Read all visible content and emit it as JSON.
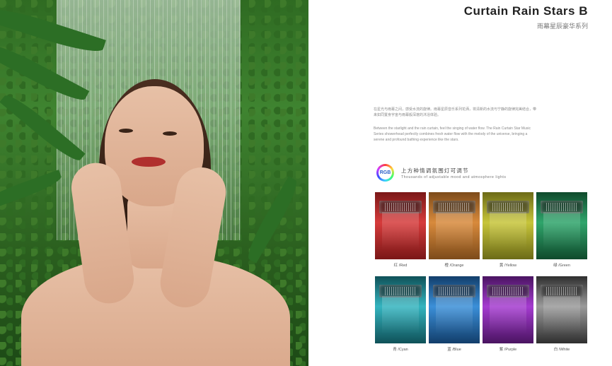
{
  "header": {
    "title": "Curtain Rain Stars B",
    "subtitle": "雨幕星辰豪华系列"
  },
  "intro": {
    "cn": "在星光与雨幕之间，感受水流的旋律。雨幕星辰音乐系列花洒，将清新的水流与宁静的旋律完美结合，带来如同置身宇宙与雨幕般深邃的沐浴体验。",
    "en": "Between the starlight and the rain curtain, feel the singing of water flow. The Rain Curtain Star Music Series showerhead perfectly combines fresh water flow with the melody of the universe, bringing a serene and profound bathing experience like the stars."
  },
  "lights": {
    "badge": "RGB",
    "heading_cn": "上方种情调氛围灯可调节",
    "heading_en": "Thousands of adjustable mood and atmosphere lights",
    "swatches": [
      {
        "label": "红 /Red",
        "color": "#d63b3b",
        "dark": "#7a1717"
      },
      {
        "label": "橙 /Orange",
        "color": "#d88a3c",
        "dark": "#7d4b1a"
      },
      {
        "label": "黄 /Yellow",
        "color": "#c7c53a",
        "dark": "#6c6b17"
      },
      {
        "label": "绿 /Green",
        "color": "#2fa56b",
        "dark": "#0f4a2c"
      },
      {
        "label": "青 /Cyan",
        "color": "#34b4bf",
        "dark": "#0f5158"
      },
      {
        "label": "蓝 /Blue",
        "color": "#3b8fd8",
        "dark": "#123e6b"
      },
      {
        "label": "紫 /Purple",
        "color": "#a53bd0",
        "dark": "#4a1461"
      },
      {
        "label": "白 /White",
        "color": "#9a9a9a",
        "dark": "#2f2f2f"
      }
    ]
  }
}
